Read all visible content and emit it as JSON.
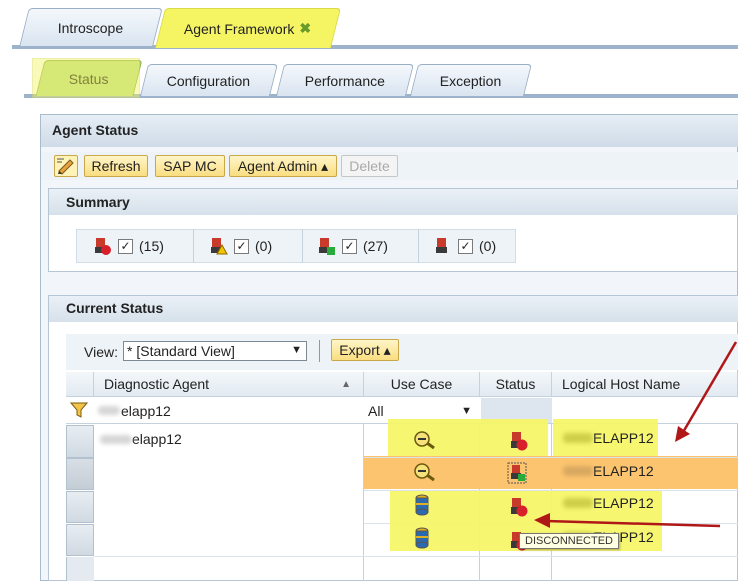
{
  "top_tabs": [
    {
      "label": "Introscope"
    },
    {
      "label": "Agent Framework",
      "close_icon": "close-icon"
    }
  ],
  "sub_tabs": [
    {
      "label": "Status"
    },
    {
      "label": "Configuration"
    },
    {
      "label": "Performance"
    },
    {
      "label": "Exception"
    }
  ],
  "panel_title": "Agent Status",
  "toolbar": {
    "refresh": "Refresh",
    "sapmc": "SAP MC",
    "agent_admin": "Agent Admin ▴",
    "delete": "Delete"
  },
  "summary": {
    "title": "Summary",
    "items": [
      {
        "icon": "agent-disconnected-icon",
        "checked": "✓",
        "count": "(15)"
      },
      {
        "icon": "agent-warning-icon",
        "checked": "✓",
        "count": "(0)"
      },
      {
        "icon": "agent-connected-icon",
        "checked": "✓",
        "count": "(27)"
      },
      {
        "icon": "agent-unknown-icon",
        "checked": "✓",
        "count": "(0)"
      }
    ]
  },
  "current_status": {
    "title": "Current Status",
    "view_label": "View:",
    "view_value": "* [Standard View]",
    "export": "Export ▴",
    "columns": [
      "Diagnostic Agent",
      "Use Case",
      "Status",
      "Logical Host Name"
    ],
    "filter": {
      "agent": "elapp12",
      "use_case": "All"
    },
    "rows": [
      {
        "agent": "elapp12",
        "use_case_icon": "introscope-icon",
        "status_icon": "agent-disconnected-icon",
        "host": "ELAPP12"
      },
      {
        "agent": "",
        "use_case_icon": "introscope-icon",
        "status_icon": "agent-connected-icon",
        "host": "ELAPP12"
      },
      {
        "agent": "",
        "use_case_icon": "database-icon",
        "status_icon": "agent-disconnected-icon",
        "host": "ELAPP12"
      },
      {
        "agent": "",
        "use_case_icon": "database-icon",
        "status_icon": "agent-disconnected-icon",
        "host": "ELAPP12"
      }
    ],
    "tooltip": "DISCONNECTED"
  },
  "colors": {
    "highlight": "#f5f564",
    "selected_row": "#fcc46e",
    "annotation_arrow": "#b01818"
  }
}
